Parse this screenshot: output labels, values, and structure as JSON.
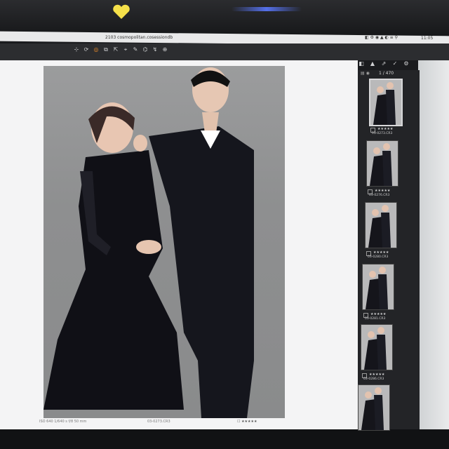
{
  "window": {
    "title": "2103 cosmopolitan.cosessiondb",
    "menu_status": "◧ ⚙ ◉ ▲ ◐ ≡ ⚲",
    "clock": "11:05"
  },
  "toolbar": {
    "tools": [
      "⊹",
      "⟳",
      "◎",
      "⧉",
      "⇱",
      "⌖",
      "✎",
      "⌬",
      "↯",
      "⊕"
    ],
    "right_tools": [
      "◧",
      "▲",
      "⇗",
      "✓",
      "⚙"
    ],
    "undo_icon": "↶"
  },
  "viewer": {
    "status_left": "ISO 640   1/640 s   f/8   50 mm",
    "filename": "03-0273.CR3",
    "rating": "☐ ★★★★★"
  },
  "filmstrip": {
    "counter": "1 / 470",
    "icons": "▤ ◉",
    "thumbnails": [
      {
        "name": "03-0273.CR3",
        "rating": "★★★★★",
        "selected": true
      },
      {
        "name": "03-0276.CR3",
        "rating": "★★★★★",
        "selected": false
      },
      {
        "name": "03-0280.CR3",
        "rating": "★★★★★",
        "selected": false
      },
      {
        "name": "03-0281.CR3",
        "rating": "★★★★★",
        "selected": false
      },
      {
        "name": "03-0286.CR3",
        "rating": "★★★★★",
        "selected": false
      },
      {
        "name": "",
        "rating": "",
        "selected": false
      }
    ]
  },
  "colors": {
    "accent": "#e98a2b",
    "app_bg": "#2c2d30",
    "viewer_bg": "#f4f4f5",
    "backdrop": "#8e8f90"
  }
}
